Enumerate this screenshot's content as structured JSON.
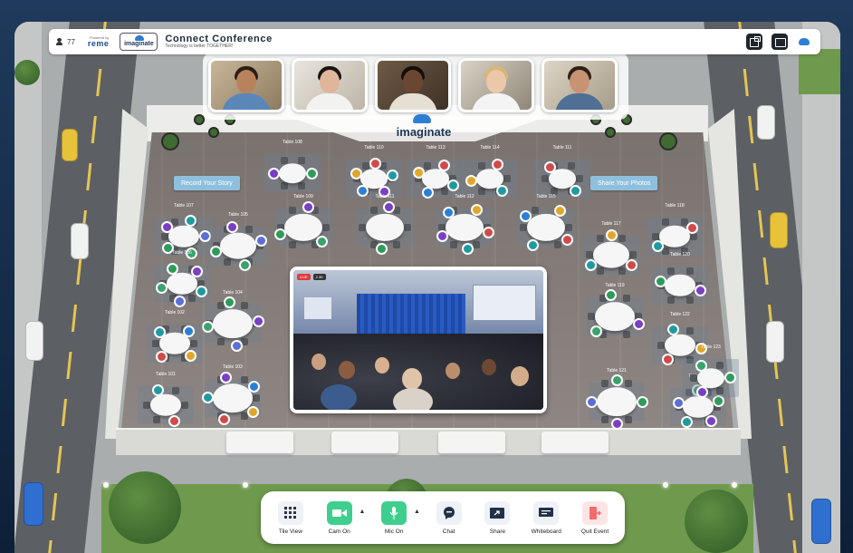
{
  "topbar": {
    "participant_count": "77",
    "powered_by": "Powered by",
    "powered_brand": "reme",
    "logo_text": "imaginate",
    "title": "Connect Conference",
    "subtitle": "Technology is better TOGETHER!"
  },
  "venue": {
    "brand": "imaginate",
    "sign_left": "Record Your Story",
    "sign_right": "Share Your Photos"
  },
  "video_tiles": [
    {
      "name": "participant-1"
    },
    {
      "name": "participant-2"
    },
    {
      "name": "participant-3"
    },
    {
      "name": "participant-4"
    },
    {
      "name": "participant-5"
    }
  ],
  "tables": [
    {
      "label": "Table 108"
    },
    {
      "label": "Table 110"
    },
    {
      "label": "Table 113"
    },
    {
      "label": "Table 114"
    },
    {
      "label": "Table 111"
    },
    {
      "label": "Table 107"
    },
    {
      "label": "Table 105"
    },
    {
      "label": "Table 109"
    },
    {
      "label": "Table 111"
    },
    {
      "label": "Table 112"
    },
    {
      "label": "Table 115"
    },
    {
      "label": "Table 117"
    },
    {
      "label": "Table 118"
    },
    {
      "label": "Table 106"
    },
    {
      "label": "Table 104"
    },
    {
      "label": "Table 119"
    },
    {
      "label": "Table 120"
    },
    {
      "label": "Table 103"
    },
    {
      "label": "Table 102"
    },
    {
      "label": "Table 122"
    },
    {
      "label": "Table 101"
    },
    {
      "label": "Table 100"
    },
    {
      "label": "Table 121"
    },
    {
      "label": "Table 123"
    }
  ],
  "main_screen": {
    "live": "LIVE",
    "views": "2.3K"
  },
  "toolbar": {
    "tile_view": "Tile View",
    "cam_on": "Cam On",
    "mic_on": "Mic On",
    "chat": "Chat",
    "share": "Share",
    "whiteboard": "Whiteboard",
    "quit": "Quit Event"
  },
  "colors": {
    "accent": "#2b7fd4",
    "cam": "#3ecf8e",
    "mic": "#3ecf8e",
    "quit": "#f26d6d",
    "sign": "#8ec0de"
  }
}
